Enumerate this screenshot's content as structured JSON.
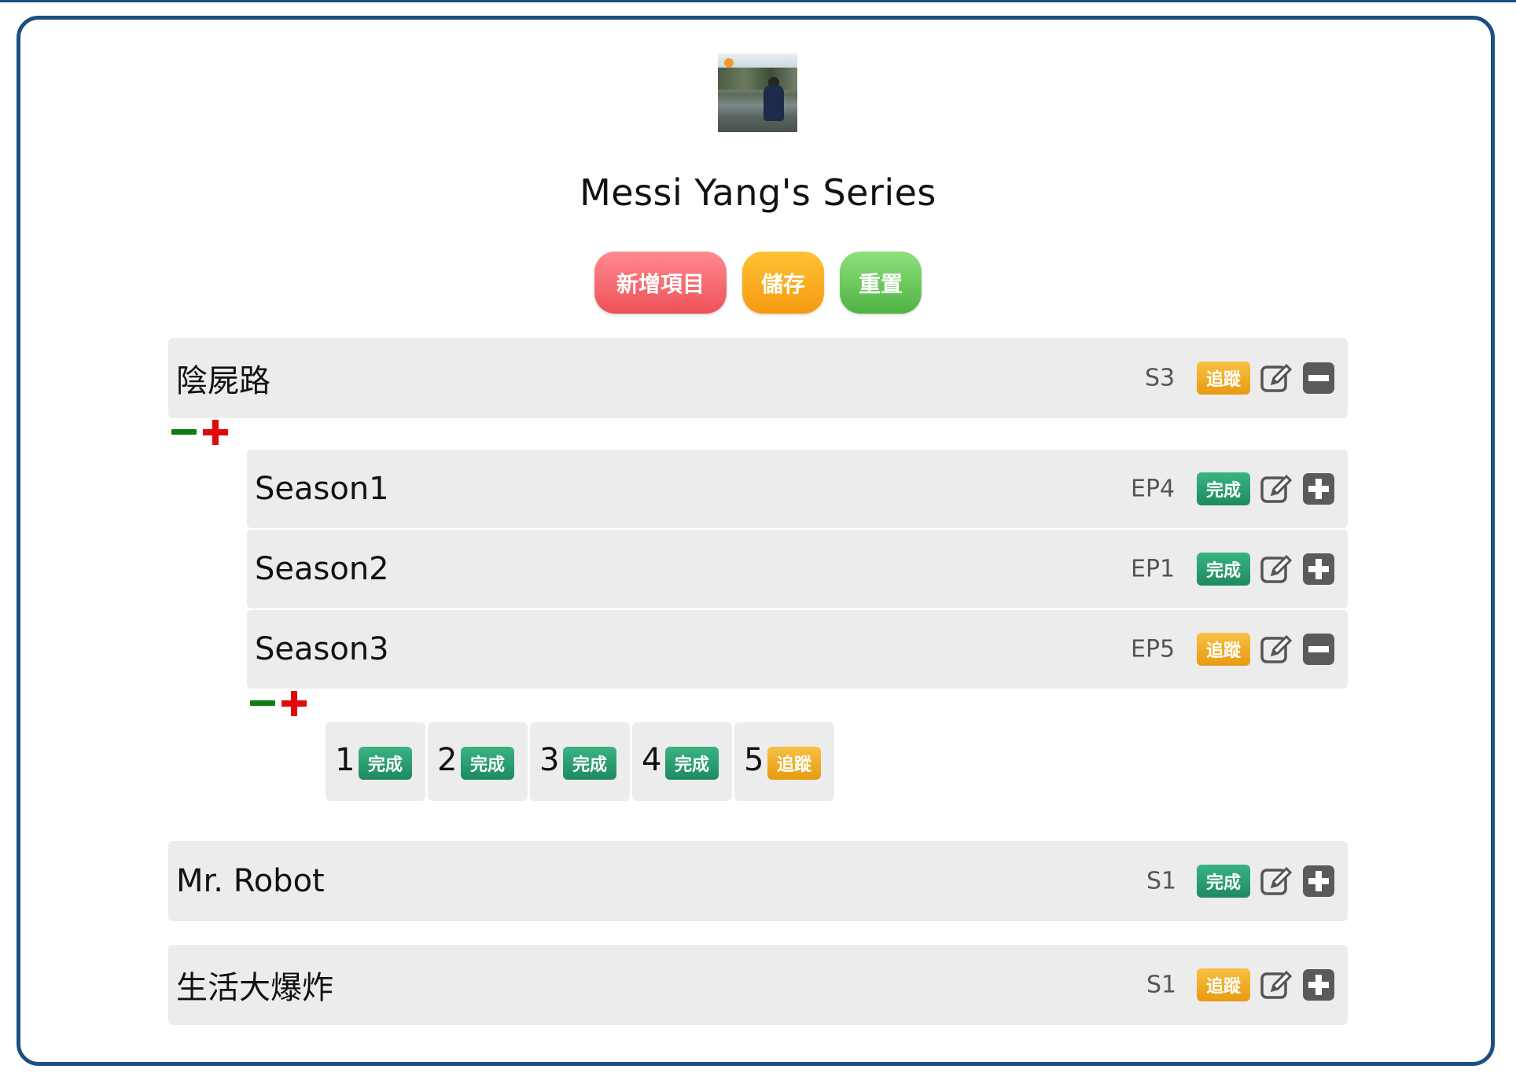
{
  "header": {
    "title": "Messi Yang's Series"
  },
  "toolbar": {
    "add_label": "新增項目",
    "save_label": "儲存",
    "reset_label": "重置"
  },
  "colors": {
    "frame": "#1b5082",
    "done_badge": "#2a9e6f",
    "track_badge": "#eea524",
    "add_button": "#f46a70",
    "save_button": "#f8ae22",
    "reset_button": "#6fca5f",
    "minus": "#0f7c14",
    "plus": "#e10a0a"
  },
  "series": [
    {
      "name": "陰屍路",
      "count": "S3",
      "status": "追蹤",
      "status_type": "track",
      "action_icon": "minus-square-icon",
      "seasons": [
        {
          "name": "Season1",
          "count": "EP4",
          "status": "完成",
          "status_type": "done",
          "action_icon": "plus-square-icon"
        },
        {
          "name": "Season2",
          "count": "EP1",
          "status": "完成",
          "status_type": "done",
          "action_icon": "plus-square-icon"
        },
        {
          "name": "Season3",
          "count": "EP5",
          "status": "追蹤",
          "status_type": "track",
          "action_icon": "minus-square-icon",
          "episodes": [
            {
              "num": "1",
              "status": "完成",
              "status_type": "done"
            },
            {
              "num": "2",
              "status": "完成",
              "status_type": "done"
            },
            {
              "num": "3",
              "status": "完成",
              "status_type": "done"
            },
            {
              "num": "4",
              "status": "完成",
              "status_type": "done"
            },
            {
              "num": "5",
              "status": "追蹤",
              "status_type": "track"
            }
          ]
        }
      ]
    },
    {
      "name": "Mr. Robot",
      "count": "S1",
      "status": "完成",
      "status_type": "done",
      "action_icon": "plus-square-icon"
    },
    {
      "name": "生活大爆炸",
      "count": "S1",
      "status": "追蹤",
      "status_type": "track",
      "action_icon": "plus-square-icon"
    }
  ]
}
